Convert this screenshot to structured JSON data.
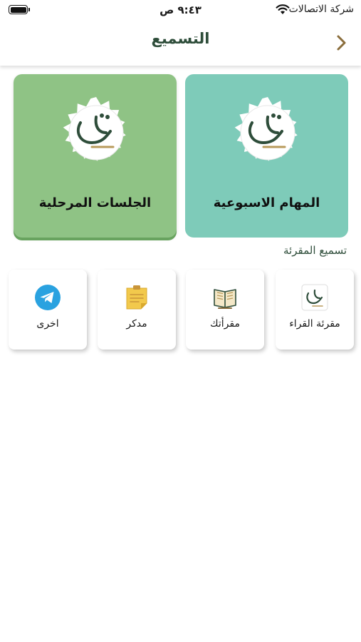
{
  "status_bar": {
    "carrier": "شركة الاتصالات",
    "time": "٩:٤٣ ص"
  },
  "header": {
    "title": "التسميع"
  },
  "cards": {
    "weekly": {
      "label": "المهام الاسبوعية"
    },
    "stage": {
      "label": "الجلسات المرحلية"
    }
  },
  "section": {
    "title": "تسميع المقرئة"
  },
  "tiles": {
    "readers": {
      "label": "مقرئة القراء"
    },
    "my_readings": {
      "label": "مقرأتك"
    },
    "notes": {
      "label": "مدكر"
    },
    "other": {
      "label": "اخرى"
    }
  },
  "colors": {
    "weekly_card": "#7ecbb9",
    "stage_card": "#8fc385",
    "title": "#2e4d3a",
    "accent_brown": "#8a6d3b",
    "telegram": "#2aa2e0",
    "sticky_note": "#f2c94c"
  }
}
